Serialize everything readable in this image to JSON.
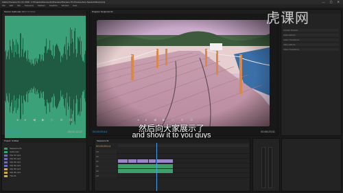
{
  "app": {
    "title": "Adobe Premiere Pro CC 2018 - F:\\Projects\\Documents\\Premiere\\Premiere Pro Preview Auto-Save\\Untitled.prproj",
    "menu": [
      "File",
      "Edit",
      "Clip",
      "Sequence",
      "Markers",
      "Graphics",
      "Window",
      "Help"
    ]
  },
  "source_monitor": {
    "tabs": [
      "Source: Audio.wav",
      "Effect Controls",
      "Audio Clip Mixer",
      "Metadata"
    ],
    "timecode_left": "00;00;00;00",
    "timecode_right": "00;01;12;27"
  },
  "program_monitor": {
    "tab": "Program: Sequence 01",
    "timecode_left": "00;00;05;14",
    "timecode_right": "00;00;23;11"
  },
  "subtitles": {
    "chinese": "然后向大家展示了",
    "english": "and show it to you guys"
  },
  "watermark": {
    "text": "虎课网"
  },
  "right_panel": {
    "tabs": [
      "Info",
      "Effects"
    ],
    "rows": [
      "Lumetri Presets",
      "Audio Effects",
      "Audio Transitions",
      "Video Effects",
      "Video Transitions"
    ]
  },
  "project": {
    "tab": "Project: Untitled",
    "items": [
      {
        "name": "Sequence 01",
        "color": "#3d9e62"
      },
      {
        "name": "Audio.wav",
        "color": "#3aa179"
      },
      {
        "name": "Clip 01.mp4",
        "color": "#6e6bbd"
      },
      {
        "name": "Clip 02.mp4",
        "color": "#6e6bbd"
      },
      {
        "name": "Clip 03.mp4",
        "color": "#6e6bbd"
      },
      {
        "name": "Clip 04.mp4",
        "color": "#6e6bbd"
      },
      {
        "name": "Clip 05.mp4",
        "color": "#d0a646"
      },
      {
        "name": "Clip 06.mp4",
        "color": "#d0a646"
      },
      {
        "name": "Title 01",
        "color": "#c9b24a"
      }
    ]
  },
  "timeline": {
    "tab": "Sequence 01",
    "timecode": "00;00;05;14",
    "tracks": [
      "V3",
      "V2",
      "V1",
      "A1",
      "A2",
      "A3"
    ]
  },
  "colors": {
    "waveform_bg": "#3aa179",
    "accent_blue": "#2e9bd6",
    "video_clip": "#9b85c9",
    "audio_clip": "#3f9f6b"
  }
}
